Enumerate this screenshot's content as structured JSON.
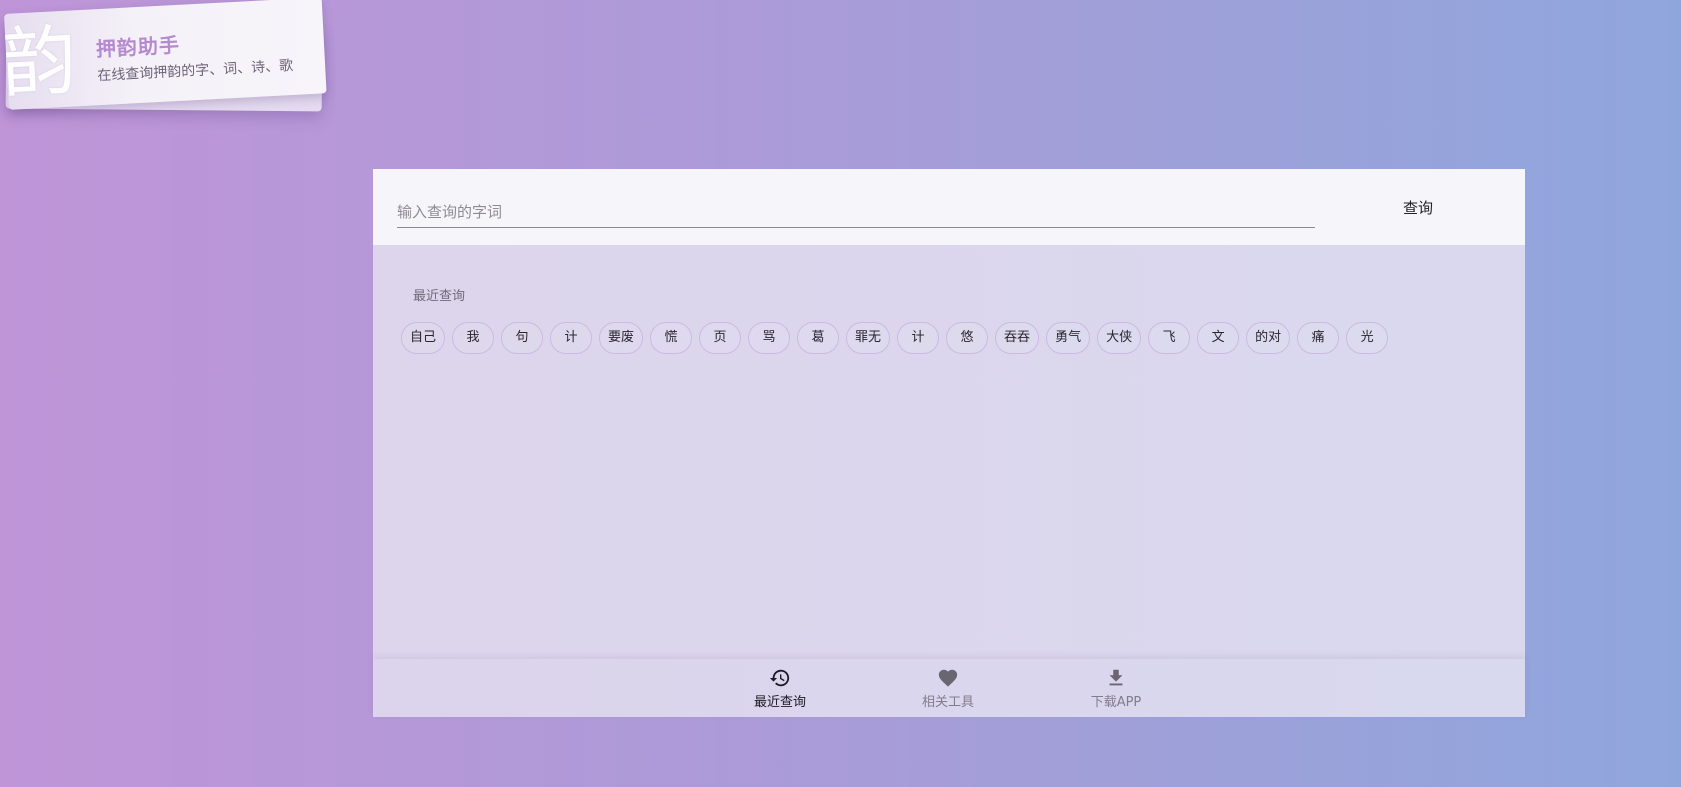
{
  "logo": {
    "glyph": "韵",
    "title": "押韵助手",
    "subtitle": "在线查询押韵的字、词、诗、歌"
  },
  "search": {
    "placeholder": "输入查询的字词",
    "value": "",
    "button_label": "查询"
  },
  "recent": {
    "label": "最近查询",
    "items": [
      "自己",
      "我",
      "句",
      "计",
      "要废",
      "慌",
      "页",
      "骂",
      "葛",
      "罪无",
      "计",
      "悠",
      "吞吞",
      "勇气",
      "大侠",
      "飞",
      "文",
      "的对",
      "痛",
      "光"
    ]
  },
  "bottom_nav": {
    "items": [
      {
        "label": "最近查询",
        "icon": "history-icon",
        "active": true
      },
      {
        "label": "相关工具",
        "icon": "heart-icon",
        "active": false
      },
      {
        "label": "下载APP",
        "icon": "download-icon",
        "active": false
      }
    ]
  },
  "colors": {
    "accent": "#b58ad0",
    "chip_border": "#cdb9e3",
    "panel": "#dbd6ed",
    "search_bar": "#f6f5fa"
  }
}
